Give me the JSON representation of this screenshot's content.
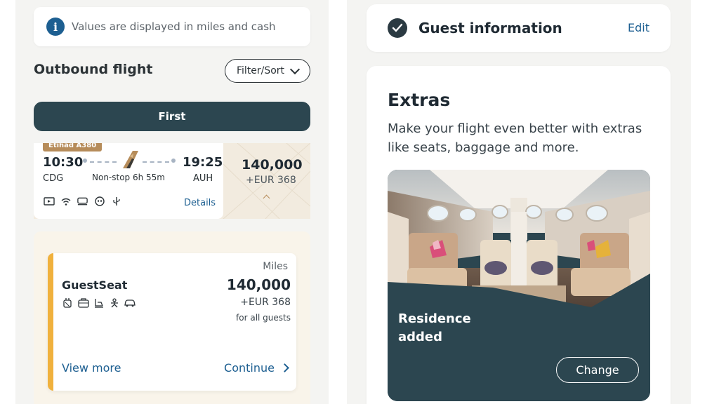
{
  "left": {
    "info_banner": {
      "icon": "info-icon",
      "text": "Values are displayed in miles and cash"
    },
    "outbound_title": "Outbound flight",
    "filter_label": "Filter/Sort",
    "class_tab": "First",
    "flight": {
      "aircraft": "Etihad A380",
      "departure_time": "10:30",
      "departure_airport": "CDG",
      "arrival_time": "19:25",
      "arrival_airport": "AUH",
      "duration": "Non-stop 6h 55m",
      "amenities": [
        "tv-icon",
        "wifi-icon",
        "seat-icon",
        "power-icon",
        "usb-icon"
      ],
      "details_label": "Details",
      "price_miles": "140,000",
      "price_cash": "+EUR 368"
    },
    "fare": {
      "name": "GuestSeat",
      "icons": [
        "hand-baggage-icon",
        "checked-baggage-icon",
        "seat-select-icon",
        "change-icon",
        "upgrade-icon"
      ],
      "miles_label": "Miles",
      "miles": "140,000",
      "cash": "+EUR 368",
      "note": "for all guests",
      "view_more": "View more",
      "continue": "Continue"
    }
  },
  "right": {
    "guest": {
      "title": "Guest information",
      "edit": "Edit"
    },
    "extras": {
      "title": "Extras",
      "description": "Make your flight even better with extras like seats, baggage and more.",
      "image_label": "Residence added",
      "change": "Change"
    }
  },
  "colors": {
    "brand_dark": "#2c4650",
    "link_blue": "#1d5f91",
    "accent_gold": "#f0b13d",
    "badge_bronze": "#b68c5a"
  }
}
